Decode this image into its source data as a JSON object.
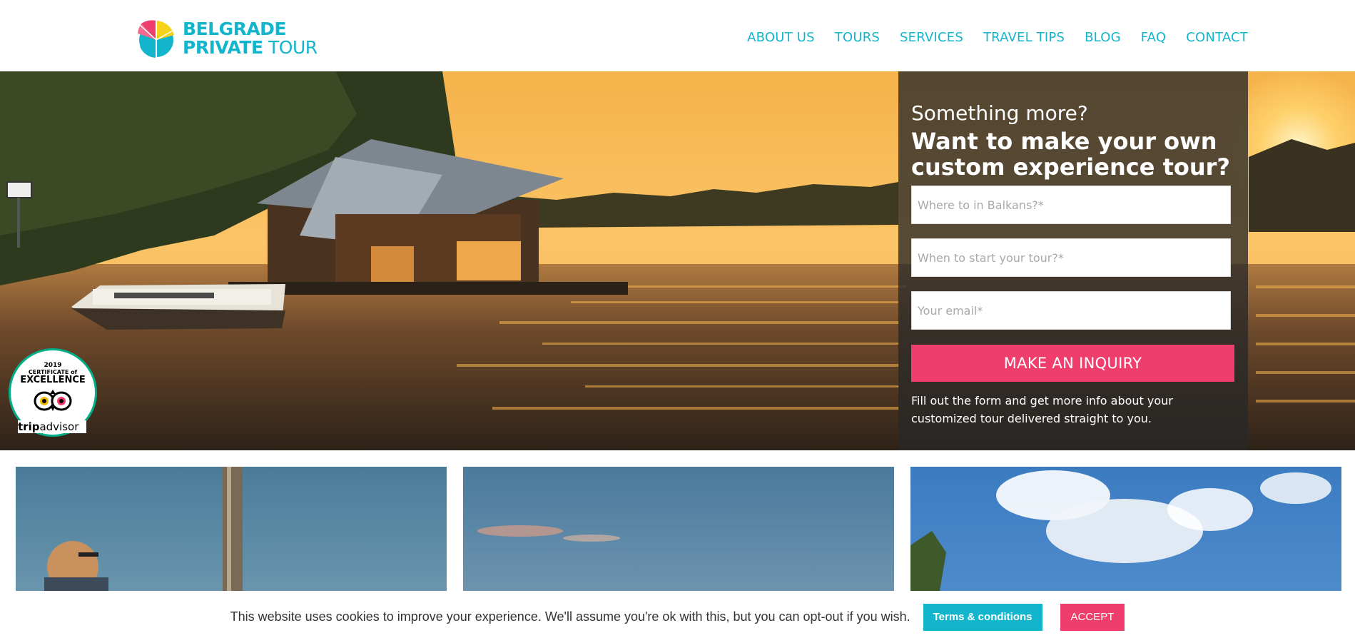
{
  "brand": {
    "line1": "BELGRADE",
    "line2_bold": "PRIVATE",
    "line2_light": " TOUR",
    "accent_color": "#13b5cc",
    "logo_icon": "sail-icon"
  },
  "nav": {
    "items": [
      {
        "label": "ABOUT US"
      },
      {
        "label": "TOURS"
      },
      {
        "label": "SERVICES"
      },
      {
        "label": "TRAVEL TIPS"
      },
      {
        "label": "BLOG"
      },
      {
        "label": "FAQ"
      },
      {
        "label": "CONTACT"
      }
    ]
  },
  "hero": {
    "panel": {
      "pre_title": "Something more?",
      "title": "Want to make your own custom experience tour?",
      "fields": {
        "destination_placeholder": "Where to in Balkans?*",
        "date_placeholder": "When to start your tour?*",
        "email_placeholder": "Your email*"
      },
      "submit_label": "MAKE AN INQUIRY",
      "note": "Fill out the form and get more info about your customized tour delivered straight to you."
    },
    "badge": {
      "year": "2019",
      "line1": "CERTIFICATE of",
      "line2": "EXCELLENCE",
      "brand_bold": "trip",
      "brand_light": "advisor",
      "icon": "owl-icon"
    }
  },
  "cookie_bar": {
    "message": "This website uses cookies to improve your experience. We'll assume you're ok with this, but you can opt-out if you wish.",
    "terms_label": "Terms & conditions",
    "accept_label": "ACCEPT"
  },
  "colors": {
    "accent": "#13b5cc",
    "cta": "#ef3e6e",
    "panel_bg": "#282828"
  }
}
